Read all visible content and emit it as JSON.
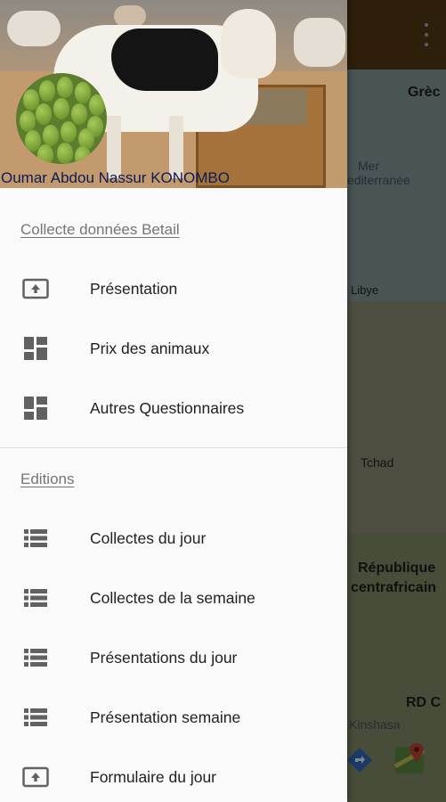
{
  "background_app": {
    "map_labels": {
      "greece": "Grèc",
      "mediterranean_line1": "Mer",
      "mediterranean_line2": "editerranée",
      "libya": "Libye",
      "chad": "Tchad",
      "car_line1": "République",
      "car_line2": "centrafricain",
      "drc": "RD C",
      "kinshasa": "Kinshasa"
    }
  },
  "drawer": {
    "header": {
      "user_name": "Oumar Abdou Nassur KONOMBO"
    },
    "sections": [
      {
        "title": "Collecte données Betail",
        "items": [
          {
            "label": "Présentation",
            "icon": "upload-box-icon"
          },
          {
            "label": "Prix des animaux",
            "icon": "dashboard-icon"
          },
          {
            "label": "Autres Questionnaires",
            "icon": "dashboard-icon"
          }
        ]
      },
      {
        "title": "Editions",
        "items": [
          {
            "label": "Collectes du jour",
            "icon": "list-icon"
          },
          {
            "label": "Collectes de la semaine",
            "icon": "list-icon"
          },
          {
            "label": "Présentations du jour",
            "icon": "list-icon"
          },
          {
            "label": "Présentation semaine",
            "icon": "list-icon"
          },
          {
            "label": "Formulaire du jour",
            "icon": "upload-box-icon"
          }
        ]
      }
    ]
  },
  "colors": {
    "app_bar": "#4a3210",
    "drawer_bg": "#fafafa",
    "user_name": "#0d1b57",
    "section_title": "#757575",
    "icon": "#616161"
  }
}
